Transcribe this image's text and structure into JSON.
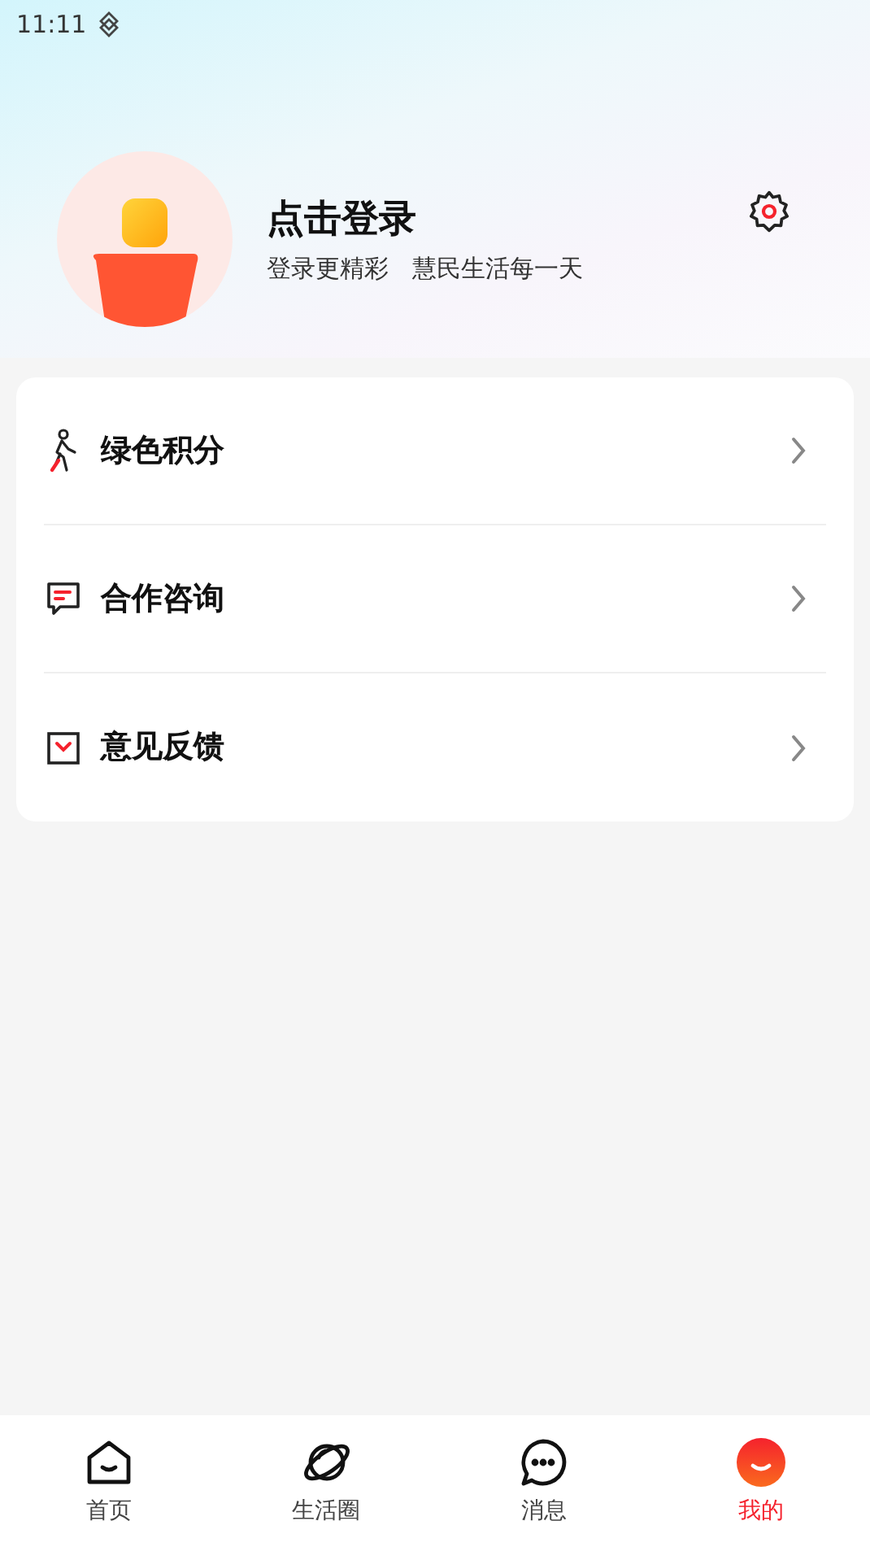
{
  "status_bar": {
    "time": "11:11"
  },
  "profile": {
    "title": "点击登录",
    "subtitle": "登录更精彩   慧民生活每一天"
  },
  "menu": [
    {
      "kind": "walk",
      "label": "绿色积分"
    },
    {
      "kind": "chat",
      "label": "合作咨询"
    },
    {
      "kind": "feedback",
      "label": "意见反馈"
    }
  ],
  "tabs": [
    {
      "kind": "home",
      "label": "首页",
      "selected": false
    },
    {
      "kind": "planet",
      "label": "生活圈",
      "selected": false
    },
    {
      "kind": "chat",
      "label": "消息",
      "selected": false
    },
    {
      "kind": "me",
      "label": "我的",
      "selected": true
    }
  ]
}
